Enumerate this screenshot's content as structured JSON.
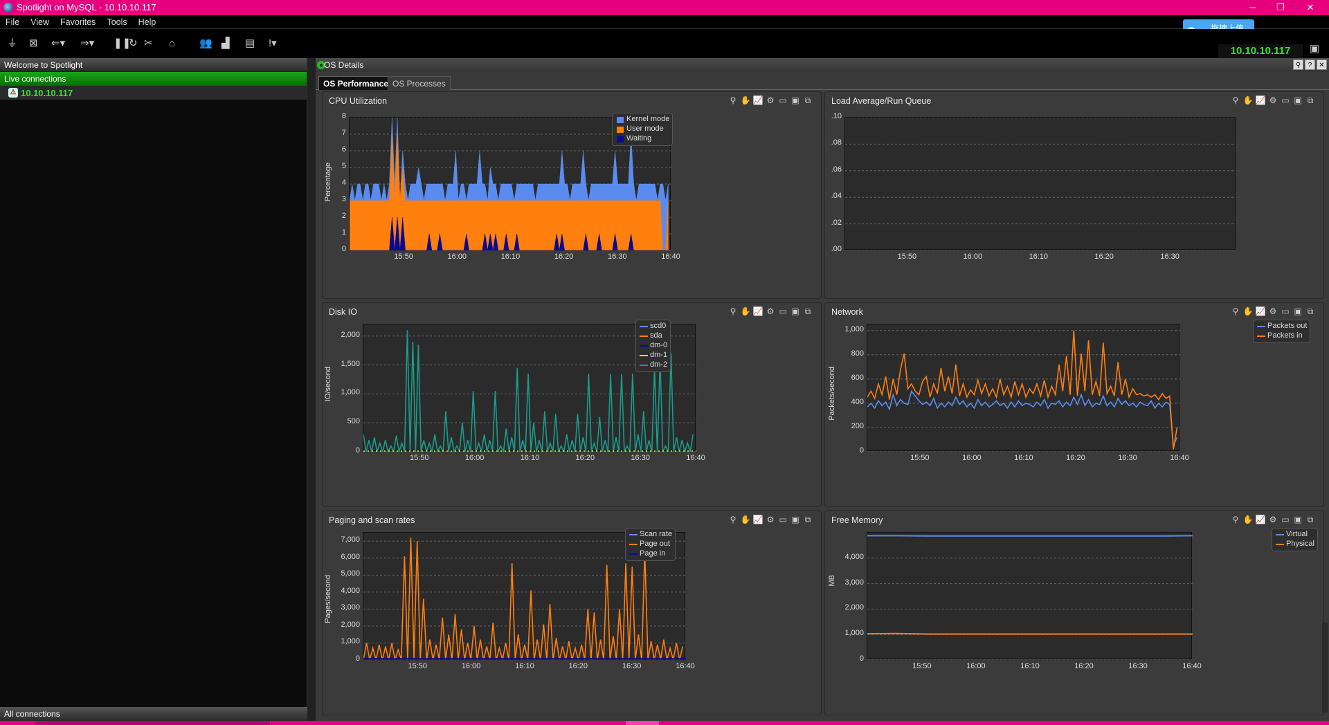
{
  "window": {
    "title": "Spotlight on MySQL - 10.10.10.117",
    "min": "─",
    "max": "❐",
    "close": "✕"
  },
  "menu": [
    "File",
    "View",
    "Favorites",
    "Tools",
    "Help"
  ],
  "toolbar": {
    "connection_ip": "10.10.10.117",
    "cloud_button": "拖拽上传"
  },
  "sidebar": {
    "welcome": "Welcome to Spotlight",
    "live_connections": "Live connections",
    "connection": "10.10.10.117",
    "all_connections": "All connections"
  },
  "main": {
    "header_title": "OS Details",
    "tabs": [
      "OS Performance",
      "OS Processes"
    ],
    "active_tab": "OS Performance"
  },
  "colors": {
    "kernel": "#5a8cf0",
    "user": "#ff7f0f",
    "waiting": "#0a0a8c",
    "scd0": "#5a8cf0",
    "sda": "#ff7f0f",
    "dm0": "#0a0a8c",
    "dm1": "#f0f01a",
    "dm2": "#1a9c8c"
  },
  "chart_data": [
    {
      "id": "cpu",
      "type": "area",
      "title": "CPU Utilization",
      "ylabel": "Percentage",
      "ylim": [
        0,
        8
      ],
      "yticks": [
        "0",
        "1",
        "2",
        "3",
        "4",
        "5",
        "6",
        "7",
        "8"
      ],
      "xticks": [
        "15:50",
        "16:00",
        "16:10",
        "16:20",
        "16:30",
        "16:40"
      ],
      "series": [
        {
          "name": "Kernel mode",
          "color": "#5a8cf0",
          "values": [
            3,
            4,
            3,
            4,
            4,
            3,
            4,
            4,
            3,
            4,
            4,
            4,
            3,
            4,
            3,
            4,
            8,
            4,
            8,
            3,
            6,
            4,
            3,
            4,
            4,
            4,
            5,
            4,
            3,
            4,
            4,
            4,
            4,
            4,
            4,
            4,
            3,
            4,
            4,
            4,
            6,
            3,
            4,
            4,
            3,
            4,
            4,
            4,
            4,
            6,
            4,
            4,
            3,
            5,
            4,
            4,
            3,
            4,
            4,
            4,
            4,
            4,
            3,
            4,
            4,
            4,
            4,
            4,
            4,
            4,
            3,
            4,
            4,
            4,
            4,
            4,
            4,
            4,
            4,
            4,
            6,
            4,
            4,
            3,
            4,
            4,
            4,
            4,
            6,
            4,
            3,
            4,
            4,
            4,
            4,
            4,
            4,
            4,
            4,
            4,
            6,
            4,
            4,
            4,
            4,
            4,
            7,
            4,
            3,
            4,
            4,
            4,
            4,
            4,
            4,
            4,
            3,
            4,
            4,
            3,
            4
          ]
        },
        {
          "name": "User mode",
          "color": "#ff7f0f",
          "values": [
            3,
            3,
            3,
            3,
            3,
            3,
            3,
            3,
            3,
            3,
            3,
            3,
            3,
            3,
            3,
            3,
            7,
            3,
            7,
            3,
            5,
            3,
            3,
            3,
            3,
            3,
            3,
            3,
            3,
            3,
            3,
            3,
            3,
            3,
            3,
            3,
            3,
            3,
            3,
            3,
            3,
            3,
            3,
            3,
            3,
            3,
            3,
            3,
            3,
            3,
            3,
            3,
            3,
            3,
            3,
            3,
            3,
            3,
            3,
            3,
            3,
            3,
            3,
            3,
            3,
            3,
            3,
            3,
            3,
            3,
            3,
            3,
            3,
            3,
            3,
            3,
            3,
            3,
            3,
            3,
            3,
            3,
            3,
            3,
            3,
            3,
            3,
            3,
            3,
            3,
            3,
            3,
            3,
            3,
            3,
            3,
            3,
            3,
            3,
            3,
            3,
            3,
            3,
            3,
            3,
            3,
            3,
            3,
            3,
            3,
            3,
            3,
            3,
            3,
            3,
            3,
            3,
            3,
            0,
            0,
            3
          ]
        },
        {
          "name": "Waiting",
          "color": "#0a0a8c",
          "values": [
            0,
            0,
            0,
            0,
            0,
            0,
            0,
            0,
            0,
            0,
            0,
            0,
            0,
            0,
            0,
            0,
            2,
            0,
            2,
            0,
            2,
            0,
            0,
            0,
            0,
            0,
            0,
            0,
            0,
            0,
            1,
            0,
            0,
            0,
            1,
            0,
            0,
            0,
            0,
            0,
            0,
            0,
            0,
            0,
            1,
            0,
            0,
            0,
            0,
            0,
            0,
            1,
            0,
            1,
            0,
            1,
            0,
            0,
            0,
            1,
            0,
            0,
            0,
            1,
            0,
            0,
            0,
            0,
            0,
            0,
            0,
            0,
            0,
            0,
            0,
            0,
            0,
            0,
            1,
            0,
            1,
            0,
            0,
            0,
            0,
            0,
            0,
            0,
            0,
            1,
            0,
            0,
            0,
            0,
            1,
            0,
            0,
            0,
            0,
            0,
            1,
            0,
            0,
            0,
            0,
            0,
            1,
            0,
            0,
            0,
            0,
            0,
            0,
            0,
            0,
            0,
            0,
            0,
            0,
            0,
            0
          ]
        }
      ]
    },
    {
      "id": "load",
      "type": "line",
      "title": "Load Average/Run Queue",
      "ylim": [
        0,
        0.1
      ],
      "yticks": [
        ".00",
        ".02",
        ".04",
        ".06",
        ".08",
        ".10"
      ],
      "xticks": [
        "15:50",
        "16:00",
        "16:10",
        "16:20",
        "16:30"
      ],
      "series": []
    },
    {
      "id": "disk",
      "type": "line",
      "title": "Disk IO",
      "ylabel": "IO/second",
      "ylim": [
        0,
        2200
      ],
      "yticks": [
        "0",
        "500",
        "1,000",
        "1,500",
        "2,000"
      ],
      "xticks": [
        "15:50",
        "16:00",
        "16:10",
        "16:20",
        "16:30",
        "16:40"
      ],
      "series": [
        {
          "name": "scd0",
          "color": "#5a8cf0",
          "values": []
        },
        {
          "name": "sda",
          "color": "#ff7f0f",
          "values": []
        },
        {
          "name": "dm-0",
          "color": "#0a0a8c",
          "values": []
        },
        {
          "name": "dm-1",
          "color": "#f0f01a",
          "values": []
        },
        {
          "name": "dm-2",
          "color": "#1a9c8c",
          "values": [
            300,
            0,
            200,
            0,
            250,
            0,
            150,
            0,
            200,
            0,
            100,
            0,
            280,
            0,
            150,
            0,
            2100,
            0,
            1900,
            0,
            1850,
            0,
            200,
            0,
            150,
            0,
            300,
            0,
            100,
            0,
            700,
            0,
            250,
            0,
            100,
            0,
            500,
            0,
            200,
            0,
            1050,
            0,
            150,
            0,
            300,
            0,
            200,
            0,
            1050,
            0,
            100,
            0,
            400,
            0,
            250,
            0,
            1450,
            0,
            200,
            0,
            1350,
            0,
            500,
            0,
            200,
            0,
            700,
            0,
            150,
            0,
            650,
            0,
            100,
            0,
            300,
            0,
            200,
            0,
            650,
            0,
            250,
            0,
            1350,
            0,
            150,
            0,
            600,
            0,
            200,
            0,
            1350,
            0,
            250,
            0,
            1350,
            0,
            100,
            0,
            1350,
            0,
            300,
            0,
            700,
            0,
            200,
            0,
            1450,
            0,
            1600,
            0,
            100,
            0,
            1700,
            0,
            250,
            0,
            200,
            0,
            150,
            0,
            300
          ]
        }
      ]
    },
    {
      "id": "network",
      "type": "line",
      "title": "Network",
      "ylabel": "Packets/second",
      "ylim": [
        0,
        1050
      ],
      "yticks": [
        "0",
        "200",
        "400",
        "600",
        "800",
        "1,000"
      ],
      "xticks": [
        "15:50",
        "16:00",
        "16:10",
        "16:20",
        "16:30",
        "16:40"
      ],
      "series": [
        {
          "name": "Packets out",
          "color": "#5a8cf0",
          "values": [
            370,
            400,
            360,
            420,
            380,
            410,
            350,
            470,
            380,
            430,
            400,
            390,
            500,
            460,
            420,
            390,
            410,
            380,
            440,
            360,
            400,
            370,
            410,
            380,
            450,
            390,
            420,
            370,
            400,
            360,
            430,
            380,
            410,
            370,
            390,
            420,
            380,
            400,
            360,
            410,
            370,
            420,
            380,
            400,
            390,
            370,
            410,
            380,
            430,
            360,
            400,
            390,
            420,
            370,
            410,
            380,
            450,
            390,
            470,
            380,
            430,
            370,
            400,
            390,
            460,
            380,
            410,
            370,
            440,
            390,
            420,
            380,
            400,
            370,
            410,
            390,
            380,
            420,
            360,
            400,
            370,
            410,
            390,
            50,
            120
          ]
        },
        {
          "name": "Packets in",
          "color": "#ff7f0f",
          "values": [
            450,
            500,
            440,
            560,
            470,
            620,
            430,
            600,
            470,
            680,
            810,
            520,
            560,
            500,
            470,
            580,
            620,
            450,
            560,
            480,
            690,
            500,
            620,
            480,
            720,
            460,
            560,
            450,
            510,
            470,
            590,
            480,
            560,
            460,
            520,
            450,
            600,
            470,
            540,
            450,
            580,
            470,
            560,
            450,
            520,
            480,
            560,
            460,
            590,
            450,
            540,
            470,
            720,
            500,
            790,
            470,
            1000,
            460,
            810,
            500,
            920,
            470,
            580,
            460,
            900,
            480,
            540,
            460,
            740,
            470,
            600,
            450,
            520,
            470,
            480,
            460,
            470,
            450,
            470,
            430,
            480,
            440,
            460,
            20,
            200
          ]
        }
      ]
    },
    {
      "id": "paging",
      "type": "line",
      "title": "Paging and scan rates",
      "ylabel": "Pages/second",
      "ylim": [
        0,
        7500
      ],
      "yticks": [
        "0",
        "1,000",
        "2,000",
        "3,000",
        "4,000",
        "5,000",
        "6,000",
        "7,000"
      ],
      "xticks": [
        "15:50",
        "16:00",
        "16:10",
        "16:20",
        "16:30",
        "16:40"
      ],
      "series": [
        {
          "name": "Scan rate",
          "color": "#5a8cf0",
          "values": []
        },
        {
          "name": "Page out",
          "color": "#ff7f0f",
          "values": [
            0,
            1000,
            0,
            700,
            0,
            900,
            0,
            800,
            0,
            1000,
            0,
            600,
            0,
            6100,
            0,
            7200,
            0,
            7000,
            0,
            3600,
            0,
            1200,
            0,
            900,
            0,
            2500,
            0,
            1500,
            0,
            2700,
            0,
            1800,
            0,
            1000,
            0,
            2000,
            0,
            1200,
            0,
            800,
            0,
            2200,
            0,
            700,
            0,
            1000,
            0,
            5700,
            0,
            1500,
            0,
            900,
            0,
            4100,
            0,
            1200,
            0,
            2100,
            0,
            3300,
            0,
            1300,
            0,
            800,
            0,
            1100,
            0,
            700,
            0,
            900,
            0,
            3000,
            0,
            2800,
            0,
            1200,
            0,
            5600,
            0,
            1400,
            0,
            3000,
            0,
            5700,
            0,
            5500,
            0,
            1500,
            0,
            6400,
            0,
            1100,
            0,
            900,
            0,
            1200,
            0,
            700,
            0,
            1000,
            0,
            800
          ]
        },
        {
          "name": "Page in",
          "color": "#0a0a8c",
          "values": []
        }
      ]
    },
    {
      "id": "memory",
      "type": "line",
      "title": "Free Memory",
      "ylabel": "MB",
      "ylim": [
        0,
        5000
      ],
      "yticks": [
        "0",
        "1,000",
        "2,000",
        "3,000",
        "4,000"
      ],
      "xticks": [
        "15:50",
        "16:00",
        "16:10",
        "16:20",
        "16:30",
        "16:40"
      ],
      "series": [
        {
          "name": "Virtual",
          "color": "#5a8cf0",
          "values": [
            4880,
            4880,
            4870,
            4870,
            4870,
            4870,
            4870,
            4870,
            4870,
            4870,
            4870,
            4880
          ]
        },
        {
          "name": "Physical",
          "color": "#ff7f0f",
          "values": [
            1030,
            1040,
            1020,
            1020,
            1020,
            1020,
            1020,
            1020,
            1020,
            1020,
            1020,
            1020
          ]
        }
      ]
    }
  ]
}
